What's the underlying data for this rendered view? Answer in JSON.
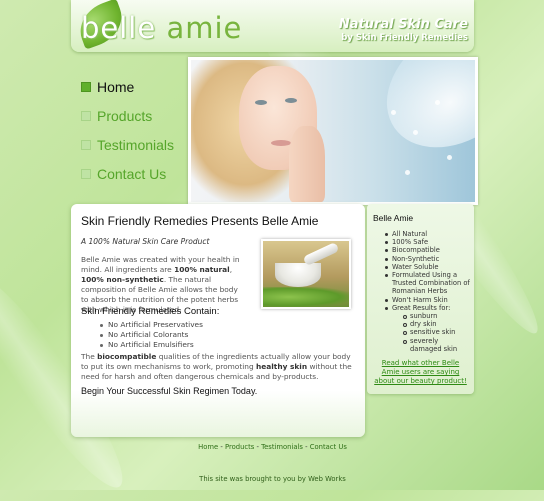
{
  "header": {
    "logo_part1": "belle ",
    "logo_part2": "amie",
    "tagline_line1": "Natural Skin Care",
    "tagline_line2": "by Skin Friendly Remedies"
  },
  "nav": {
    "items": [
      {
        "label": "Home",
        "active": true
      },
      {
        "label": "Products",
        "active": false
      },
      {
        "label": "Testimonials",
        "active": false
      },
      {
        "label": "Contact Us",
        "active": false
      }
    ]
  },
  "main": {
    "title": "Skin Friendly Remedies Presents Belle Amie",
    "subtitle": "A 100% Natural Skin Care Product",
    "para1_a": "Belle Amie was created with your health in mind. All ingredients are ",
    "para1_bold1": "100% natural",
    "para1_sep": ", ",
    "para1_bold2": "100% non-synthetic",
    "para1_b": ". The natural composition of Belle Amie allows the body to absorb the nutrition of the potent herbs with which it is formulated.",
    "section_head": "Skin Friendly Remedies Contain:",
    "contains": [
      "No Artificial Preservatives",
      "No Artificial Colorants",
      "No Artificial Emulsifiers"
    ],
    "para2_a": "The ",
    "para2_bold1": "biocompatible",
    "para2_b": " qualities of the ingredients actually allow your body to put its own mechanisms to work, promoting ",
    "para2_bold2": "healthy skin",
    "para2_c": " without the need for harsh and often dangerous chemicals and by-products.",
    "closing": "Begin Your Successful Skin Regimen Today."
  },
  "sidebar": {
    "title": "Belle Amie",
    "features": [
      "All Natural",
      "100% Safe",
      "Biocompatible",
      "Non-Synthetic",
      "Water Soluble",
      "Formulated Using a Trusted Combination of Romanian Herbs",
      "Won't Harm Skin",
      "Great Results for:"
    ],
    "results_for": [
      "sunburn",
      "dry skin",
      "sensitive skin",
      "severely damaged skin"
    ],
    "link_text": "Read what other Belle Amie users are saying about our beauty product!"
  },
  "footer": {
    "links": [
      "Home",
      "Products",
      "Testimonials",
      "Contact Us"
    ],
    "separator": " - ",
    "credit": "This site was brought to you by Web Works"
  },
  "colors": {
    "brand_green": "#55a52a",
    "link_green": "#2e8a14",
    "active_bullet": "#5fb02b"
  }
}
